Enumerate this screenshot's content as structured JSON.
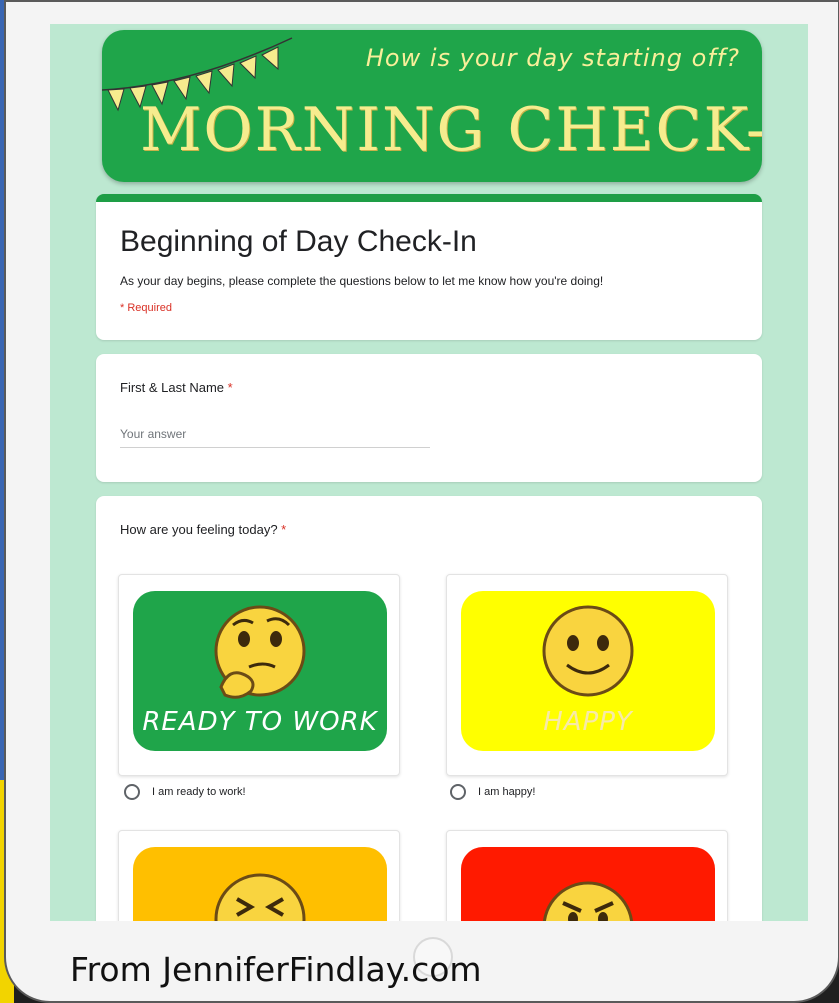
{
  "banner": {
    "subtitle": "How is your day starting off?",
    "title": "MORNING CHECK-IN"
  },
  "form": {
    "title": "Beginning of Day Check-In",
    "description": "As your day begins, please complete the questions below to let me know how you're doing!",
    "required_note": "* Required"
  },
  "name_question": {
    "label": "First & Last Name",
    "required_marker": "*",
    "placeholder": "Your answer"
  },
  "feeling_question": {
    "label": "How are you feeling today?",
    "required_marker": "*",
    "options": [
      {
        "image_text": "READY TO WORK",
        "label": "I am ready to work!",
        "color": "#1fa54a",
        "text_color": "#ffffff"
      },
      {
        "image_text": "HAPPY",
        "label": "I am happy!",
        "color": "#ffff00",
        "text_color": "#f7e9a8"
      },
      {
        "image_text": "",
        "label": "",
        "color": "#ffbf00",
        "text_color": "#ffffff"
      },
      {
        "image_text": "",
        "label": "",
        "color": "#ff1a00",
        "text_color": "#ffffff"
      }
    ]
  },
  "credit": "From JenniferFindlay.com",
  "colors": {
    "form_bg": "#bde8d1",
    "accent": "#1e9e46",
    "required": "#d93025"
  },
  "icons": [
    "thinking-face-icon",
    "smiley-face-icon",
    "tired-face-icon",
    "angry-face-icon",
    "home-button"
  ]
}
